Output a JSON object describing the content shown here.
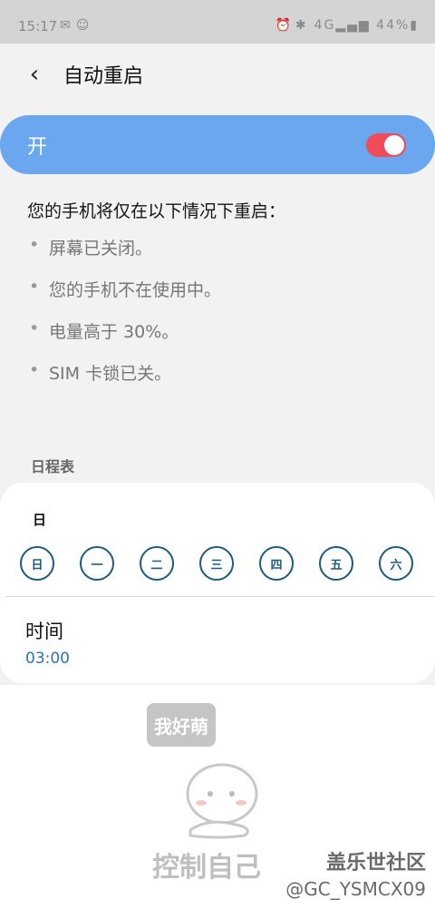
{
  "status_bar": {
    "time": "15:17",
    "battery": "44%",
    "network": "4G"
  },
  "header": {
    "title": "自动重启"
  },
  "toggle": {
    "label": "开",
    "on": true,
    "color": "#ef4c59",
    "bg": "#6aa7ef"
  },
  "description": "您的手机将仅在以下情况下重启：",
  "conditions": [
    "屏幕已关闭。",
    "您的手机不在使用中。",
    "电量高于 30%。",
    "SIM 卡锁已关。"
  ],
  "schedule": {
    "section_title": "日程表",
    "days_label": "日",
    "days": [
      "日",
      "一",
      "二",
      "三",
      "四",
      "五",
      "六"
    ],
    "time_label": "时间",
    "time_value": "03:00"
  },
  "watermark": {
    "bubble": "我好萌",
    "caption": "控制自己",
    "brand": "盖乐世社区",
    "handle": "@GC_YSMCX09"
  }
}
